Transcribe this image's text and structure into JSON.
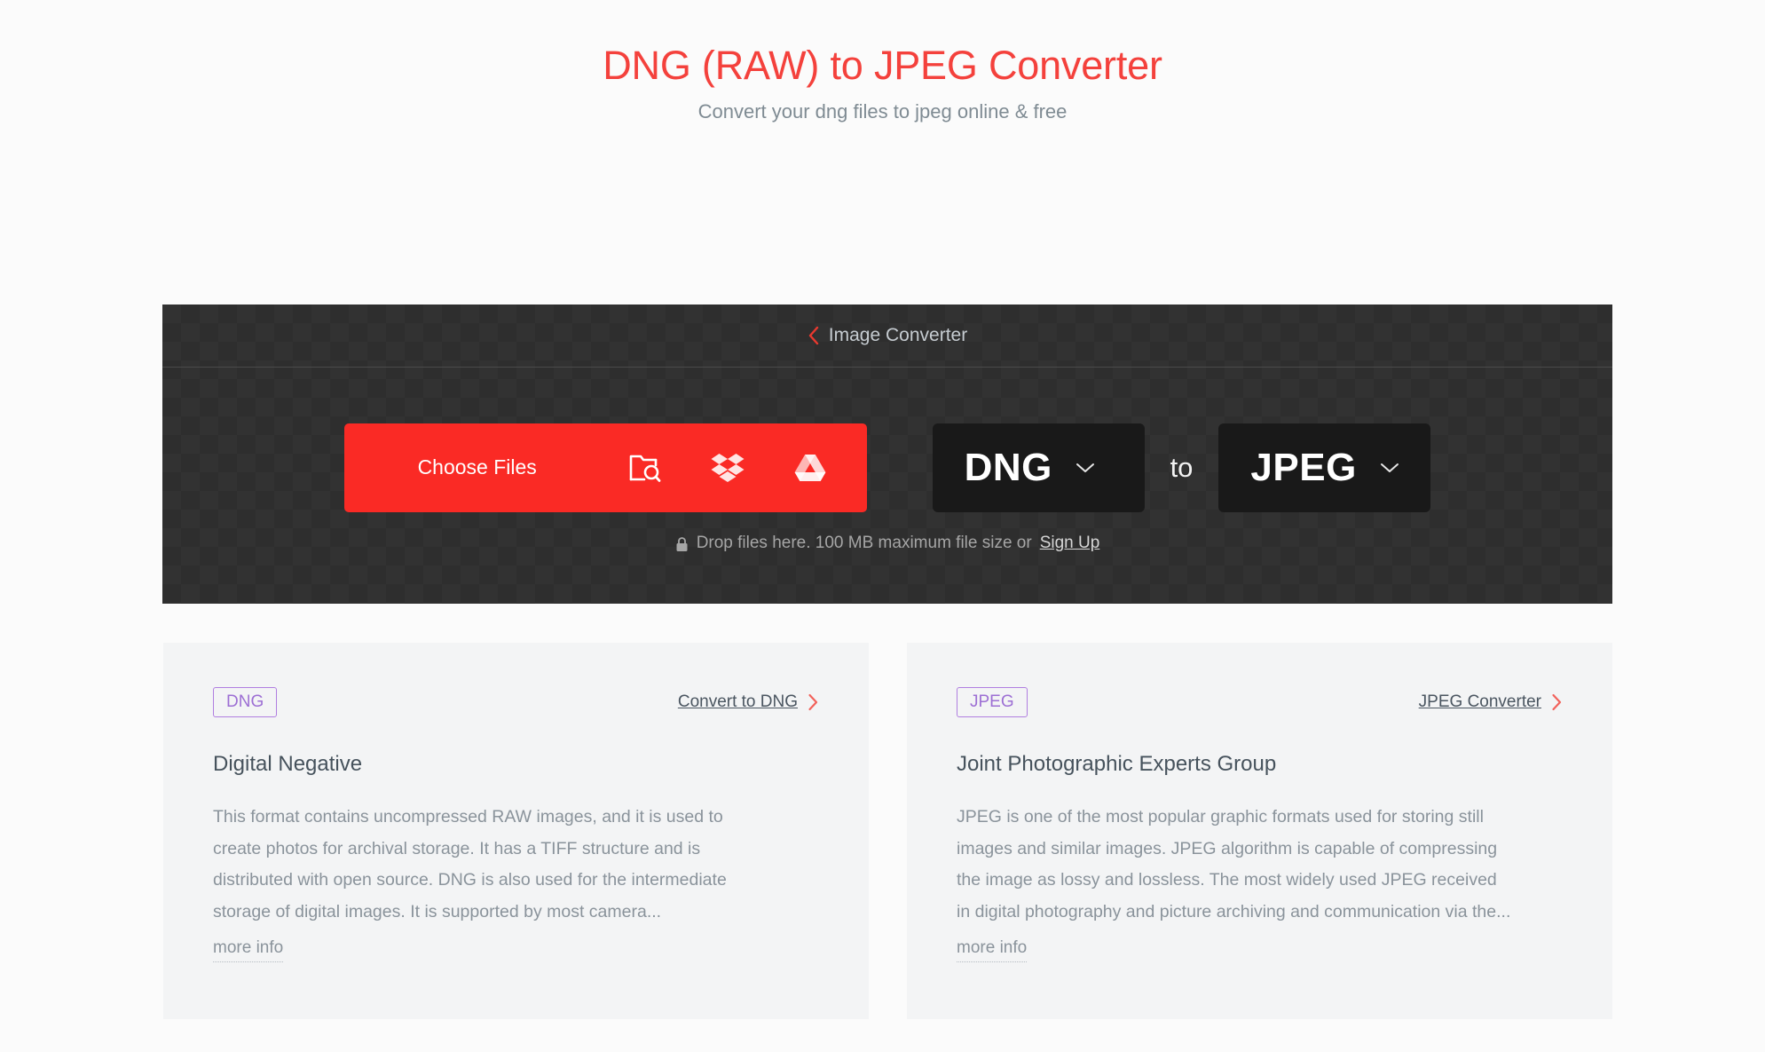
{
  "header": {
    "title": "DNG (RAW) to JPEG Converter",
    "subtitle": "Convert your dng files to jpeg online & free",
    "title_color": "#f4413c"
  },
  "converter": {
    "breadcrumb": {
      "label": "Image Converter",
      "chevron_icon": "chevron-left-icon"
    },
    "choose_files": {
      "label": "Choose Files",
      "color": "#fa2a25",
      "sources": [
        {
          "icon": "folder-search-icon",
          "name": "local-files"
        },
        {
          "icon": "dropbox-icon",
          "name": "dropbox"
        },
        {
          "icon": "google-drive-icon",
          "name": "google-drive"
        }
      ]
    },
    "from_format": {
      "value": "DNG",
      "caret_icon": "chevron-down-icon"
    },
    "to_word": "to",
    "to_format": {
      "value": "JPEG",
      "caret_icon": "chevron-down-icon"
    },
    "drop_hint": {
      "lock_icon": "lock-icon",
      "text": "Drop files here. 100 MB maximum file size or",
      "link_label": "Sign Up"
    }
  },
  "cards": [
    {
      "badge": "DNG",
      "link_label": "Convert to DNG",
      "link_chevron_icon": "chevron-right-icon",
      "title": "Digital Negative",
      "description": "This format contains uncompressed RAW images, and it is used to create photos for archival storage. It has a TIFF structure and is distributed with open source. DNG is also used for the intermediate storage of digital images. It is supported by most camera...",
      "more_info_label": "more info"
    },
    {
      "badge": "JPEG",
      "link_label": "JPEG Converter",
      "link_chevron_icon": "chevron-right-icon",
      "title": "Joint Photographic Experts Group",
      "description": "JPEG is one of the most popular graphic formats used for storing still images and similar images. JPEG algorithm is capable of compressing the image as lossy and lossless. The most widely used JPEG received in digital photography and picture archiving and communication via the...",
      "more_info_label": "more info"
    }
  ]
}
